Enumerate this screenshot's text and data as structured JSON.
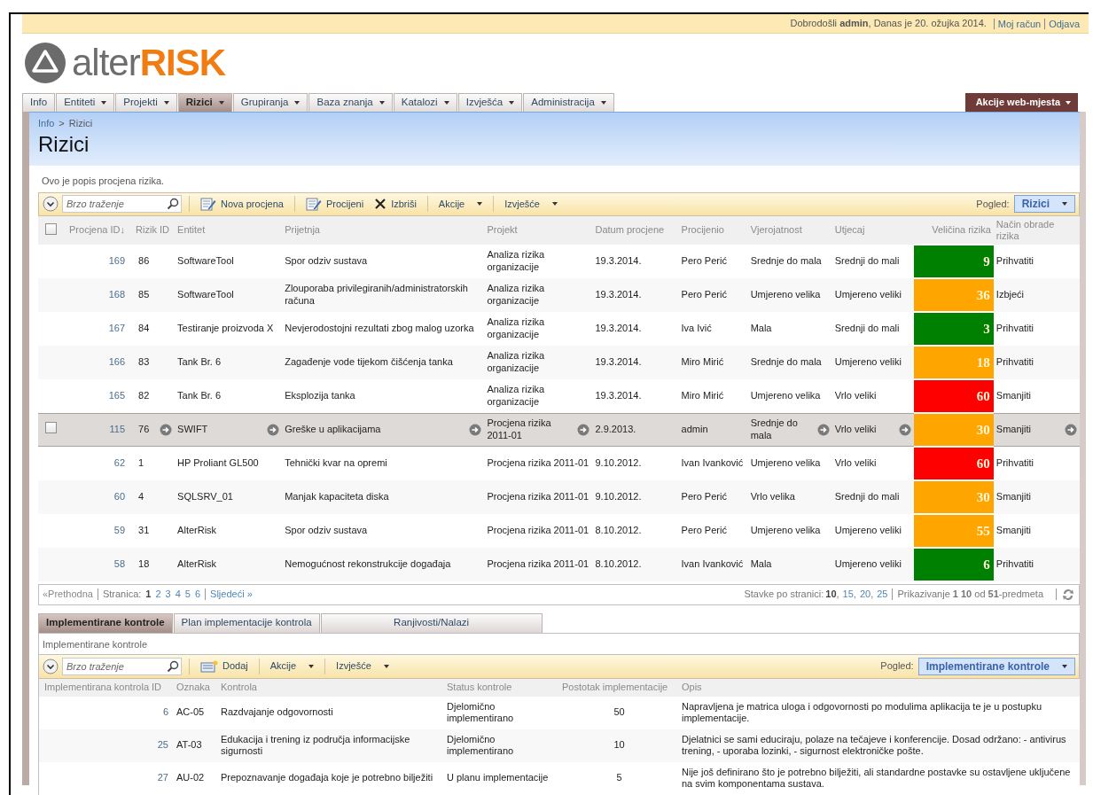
{
  "top_bar": {
    "greeting": "Dobrodošli **admin**, Danas je 20. ožujka 2014.",
    "links": [
      "Moj račun",
      "Odjava"
    ]
  },
  "logo": {
    "light": "alter",
    "bold": "RISK"
  },
  "nav": {
    "items": [
      {
        "label": "Info",
        "dropdown": false,
        "selected": false
      },
      {
        "label": "Entiteti",
        "dropdown": true,
        "selected": false
      },
      {
        "label": "Projekti",
        "dropdown": true,
        "selected": false
      },
      {
        "label": "Rizici",
        "dropdown": true,
        "selected": true
      },
      {
        "label": "Grupiranja",
        "dropdown": true,
        "selected": false
      },
      {
        "label": "Baza znanja",
        "dropdown": true,
        "selected": false
      },
      {
        "label": "Katalozi",
        "dropdown": true,
        "selected": false
      },
      {
        "label": "Izvješća",
        "dropdown": true,
        "selected": false
      },
      {
        "label": "Administracija",
        "dropdown": true,
        "selected": false
      }
    ],
    "site_actions": "Akcije web-mjesta"
  },
  "breadcrumb": {
    "items": [
      "Info",
      "Rizici"
    ],
    "separator": ">"
  },
  "page_title": "Rizici",
  "description": "Ovo je popis procjena rizika.",
  "risk_list": {
    "toolbar": {
      "search_placeholder": "Brzo traženje",
      "items": [
        {
          "kind": "new",
          "label": "Nova procjena",
          "separator": true
        },
        {
          "kind": "assess",
          "label": "Procijeni",
          "separator": true
        },
        {
          "kind": "delete",
          "label": "Izbriši",
          "separator": false
        },
        {
          "kind": "menu",
          "label": "Akcije",
          "separator": true
        },
        {
          "kind": "menu",
          "label": "Izvješće",
          "separator": true
        }
      ],
      "view_label": "Pogled:",
      "view_value": "Rizici"
    },
    "select_all_checked": false,
    "columns": [
      {
        "label": "Procjena ID↓",
        "kind": "id",
        "menu": false
      },
      {
        "label": "Rizik ID",
        "kind": "text",
        "menu": true
      },
      {
        "label": "Entitet",
        "kind": "text",
        "menu": true
      },
      {
        "label": "Prijetnja",
        "kind": "text",
        "menu": true
      },
      {
        "label": "Projekt",
        "kind": "text",
        "menu": true
      },
      {
        "label": "Datum procjene",
        "kind": "text",
        "menu": false
      },
      {
        "label": "Procijenio",
        "kind": "text",
        "menu": false
      },
      {
        "label": "Vjerojatnost",
        "kind": "text",
        "menu": true
      },
      {
        "label": "Utjecaj",
        "kind": "text",
        "menu": true
      },
      {
        "label": "Veličina rizika",
        "kind": "score",
        "menu": false
      },
      {
        "label": "Način obrade rizika",
        "kind": "text",
        "menu": true
      }
    ],
    "rows": [
      {
        "selected": false,
        "color": "#008000",
        "cells": [
          "169",
          "86",
          "SoftwareTool",
          "Spor odziv sustava",
          "Analiza rizika organizacije",
          "19.3.2014.",
          "Pero Perić",
          "Srednje do mala",
          "Srednji do mali",
          "9",
          "Prihvatiti"
        ]
      },
      {
        "selected": false,
        "color": "#ffa500",
        "cells": [
          "168",
          "85",
          "SoftwareTool",
          "Zlouporaba privilegiranih/administratorskih računa",
          "Analiza rizika organizacije",
          "19.3.2014.",
          "Pero Perić",
          "Umjereno velika",
          "Umjereno veliki",
          "36",
          "Izbjeći"
        ]
      },
      {
        "selected": false,
        "color": "#008000",
        "cells": [
          "167",
          "84",
          "Testiranje proizvoda X",
          "Nevjerodostojni rezultati zbog malog uzorka",
          "Analiza rizika organizacije",
          "19.3.2014.",
          "Iva Ivić",
          "Mala",
          "Srednji do mali",
          "3",
          "Prihvatiti"
        ]
      },
      {
        "selected": false,
        "color": "#ffa500",
        "cells": [
          "166",
          "83",
          "Tank Br. 6",
          "Zagađenje vode tijekom čišćenja tanka",
          "Analiza rizika organizacije",
          "19.3.2014.",
          "Miro Mirić",
          "Srednje do mala",
          "Umjereno veliki",
          "18",
          "Prihvatiti"
        ]
      },
      {
        "selected": false,
        "color": "#ff0000",
        "cells": [
          "165",
          "82",
          "Tank Br. 6",
          "Eksplozija tanka",
          "Analiza rizika organizacije",
          "19.3.2014.",
          "Miro Mirić",
          "Umjereno velika",
          "Vrlo veliki",
          "60",
          "Smanjiti"
        ]
      },
      {
        "selected": true,
        "color": "#ffa500",
        "cells": [
          "115",
          "76",
          "SWIFT",
          "Greške u aplikacijama",
          "Procjena rizika 2011-01",
          "2.9.2013.",
          "admin",
          "Srednje do mala",
          "Vrlo veliki",
          "30",
          "Smanjiti"
        ]
      },
      {
        "selected": false,
        "color": "#ff0000",
        "cells": [
          "62",
          "1",
          "HP Proliant GL500",
          "Tehnički kvar na opremi",
          "Procjena rizika 2011-01",
          "9.10.2012.",
          "Ivan Ivanković",
          "Umjereno velika",
          "Vrlo veliki",
          "60",
          "Prihvatiti"
        ]
      },
      {
        "selected": false,
        "color": "#ffa500",
        "cells": [
          "60",
          "4",
          "SQLSRV_01",
          "Manjak kapaciteta diska",
          "Procjena rizika 2011-01",
          "9.10.2012.",
          "Pero Perić",
          "Vrlo velika",
          "Srednji do mali",
          "30",
          "Smanjiti"
        ]
      },
      {
        "selected": false,
        "color": "#ffa500",
        "cells": [
          "59",
          "31",
          "AlterRisk",
          "Spor odziv sustava",
          "Procjena rizika 2011-01",
          "8.10.2012.",
          "Pero Perić",
          "Umjereno velika",
          "Umjereno veliki",
          "55",
          "Smanjiti"
        ]
      },
      {
        "selected": false,
        "color": "#008000",
        "cells": [
          "58",
          "18",
          "AlterRisk",
          "Nemogućnost rekonstrukcije događaja",
          "Procjena rizika 2011-01",
          "8.10.2012.",
          "Ivan Ivanković",
          "Mala",
          "Umjereno veliki",
          "6",
          "Prihvatiti"
        ]
      }
    ],
    "pager": {
      "prev": {
        "label": "«Prethodna",
        "disabled": true
      },
      "page_label": "Stranica:",
      "pages": [
        {
          "label": "1",
          "selected": true
        },
        {
          "label": "2",
          "selected": false
        },
        {
          "label": "3",
          "selected": false
        },
        {
          "label": "4",
          "selected": false
        },
        {
          "label": "5",
          "selected": false
        },
        {
          "label": "6",
          "selected": false
        }
      ],
      "next": {
        "label": "Sljedeći »",
        "disabled": false
      },
      "size_label": "Stavke po stranici:",
      "size_separator": ",",
      "sizes": [
        {
          "label": "10",
          "selected": true
        },
        {
          "label": "15",
          "selected": false
        },
        {
          "label": "20",
          "selected": false
        },
        {
          "label": "25",
          "selected": false
        }
      ],
      "summary": "Prikazivanje **1 10** od **51**-predmeta"
    }
  },
  "detail_tabs": [
    {
      "label": "Implementirane kontrole",
      "selected": true
    },
    {
      "label": "Plan implementacije kontrola",
      "selected": false
    },
    {
      "label": "Ranjivosti/Nalazi",
      "selected": false
    }
  ],
  "controls_panel": {
    "title": "Implementirane kontrole",
    "toolbar": {
      "search_placeholder": "Brzo traženje",
      "items": [
        {
          "kind": "add",
          "label": "Dodaj",
          "separator": true
        },
        {
          "kind": "menu",
          "label": "Akcije",
          "separator": true
        },
        {
          "kind": "menu",
          "label": "Izvješće",
          "separator": true
        }
      ],
      "view_label": "Pogled:",
      "view_value": "Implementirane kontrole"
    },
    "columns": [
      {
        "label": "Implementirana kontrola ID",
        "kind": "id"
      },
      {
        "label": "Oznaka",
        "kind": "text"
      },
      {
        "label": "Kontrola",
        "kind": "text"
      },
      {
        "label": "Status kontrole",
        "kind": "text"
      },
      {
        "label": "Postotak implementacije",
        "kind": "percent"
      },
      {
        "label": "Opis",
        "kind": "text"
      }
    ],
    "rows": [
      {
        "cells": [
          "6",
          "AC-05",
          "Razdvajanje odgovornosti",
          "Djelomično implementirano",
          "50",
          "Napravljena je matrica uloga i odgovornosti po modulima aplikacija te je u postupku implementacije."
        ]
      },
      {
        "cells": [
          "25",
          "AT-03",
          "Edukacija i trening iz područja informacijske sigurnosti",
          "Djelomično implementirano",
          "10",
          "Djelatnici se sami educiraju, polaze na tečajeve i konferencije. Dosad održano: - antivirus trening, - uporaba lozinki, - sigurnost elektroničke pošte."
        ]
      },
      {
        "cells": [
          "27",
          "AU-02",
          "Prepoznavanje događaja koje je potrebno bilježiti",
          "U planu implementacije",
          "5",
          "Nije još definirano što je potrebno bilježiti, ali standardne postavke su ostavljene uključene na svim komponentama sustava."
        ]
      }
    ]
  }
}
